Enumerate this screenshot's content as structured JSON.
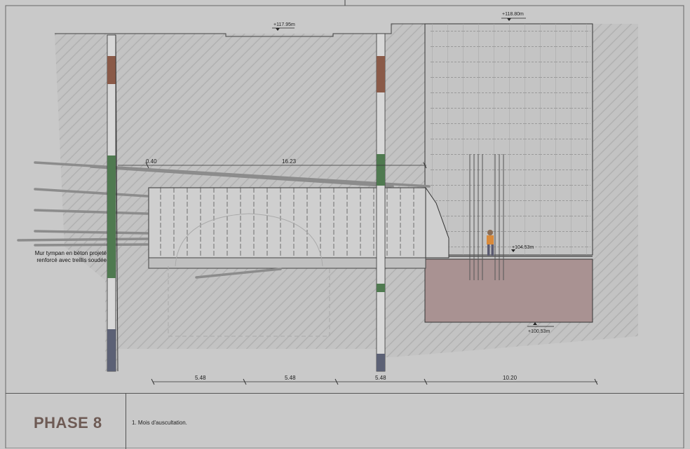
{
  "drawing": {
    "phase_title": "PHASE 8",
    "note": "1.  Mois d'auscultation.",
    "wall_label": "Mur tympan en béton projeté renforcé avec treillis soudée",
    "elevations": {
      "top_left": "+117.95m",
      "top_right": "+118.80m",
      "worker_level": "+104.53m",
      "bottom_right": "+100.53m"
    },
    "dimensions": {
      "slab_offset": "0.40",
      "slab_length": "16.23",
      "span_1": "5.48",
      "span_2": "5.48",
      "span_3": "5.48",
      "span_4": "10.20"
    },
    "colors": {
      "background": "#c9c9c9",
      "hatch": "#b3b3b3",
      "green_layer": "#4f7a50",
      "brown_layer": "#8a5a48",
      "blue_layer": "#5c6175",
      "pit": "#a99292",
      "title": "#6e5b55"
    }
  }
}
